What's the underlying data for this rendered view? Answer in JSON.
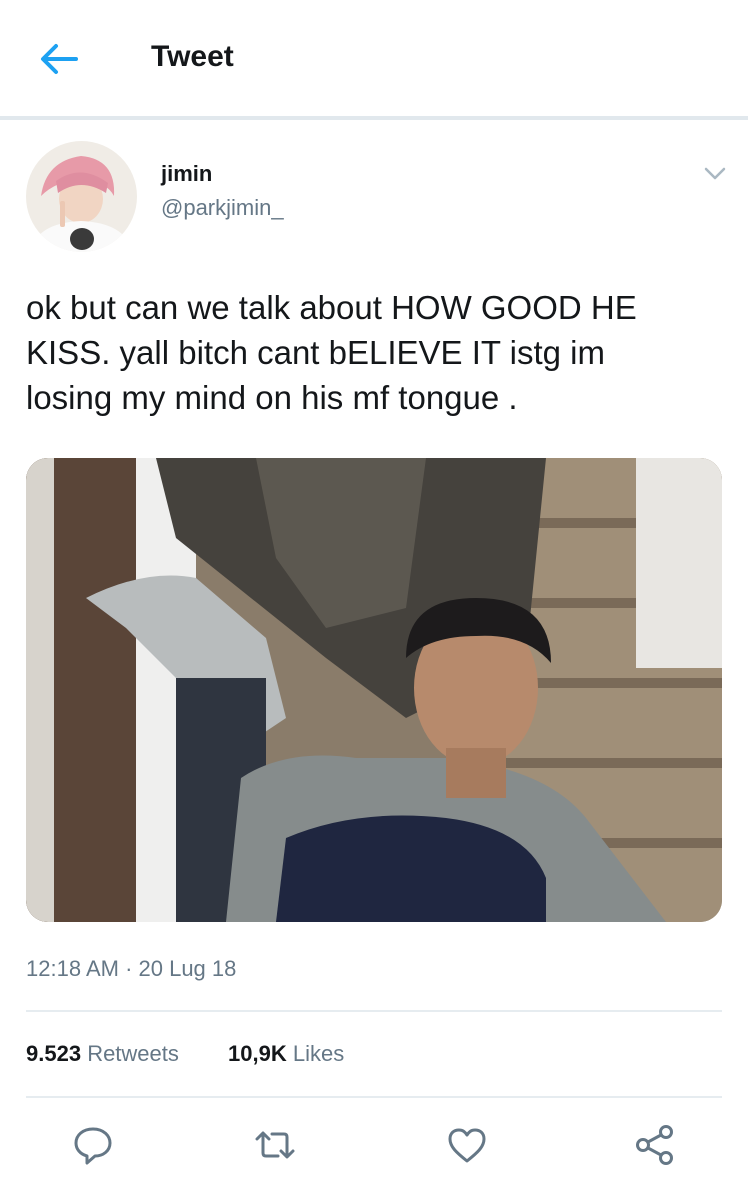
{
  "header": {
    "title": "Tweet"
  },
  "user": {
    "name": "jimin",
    "handle": "@parkjimin_"
  },
  "tweet": {
    "text_lines": [
      "ok but can we talk about HOW GOOD HE",
      "KISS. yall bitch cant bELIEVE IT istg im",
      "losing my mind on his mf tongue ."
    ],
    "timestamp": "12:18 AM · 20 Lug 18"
  },
  "stats": {
    "retweets_count": "9.523",
    "retweets_label": "Retweets",
    "likes_count": "10,9K",
    "likes_label": "Likes"
  },
  "colors": {
    "accent": "#1da1f2",
    "text": "#14171a",
    "secondary": "#657786",
    "divider": "#e6ecf0"
  },
  "icons": [
    "back-arrow-icon",
    "chevron-down-icon",
    "reply-icon",
    "retweet-icon",
    "like-icon",
    "share-icon"
  ]
}
